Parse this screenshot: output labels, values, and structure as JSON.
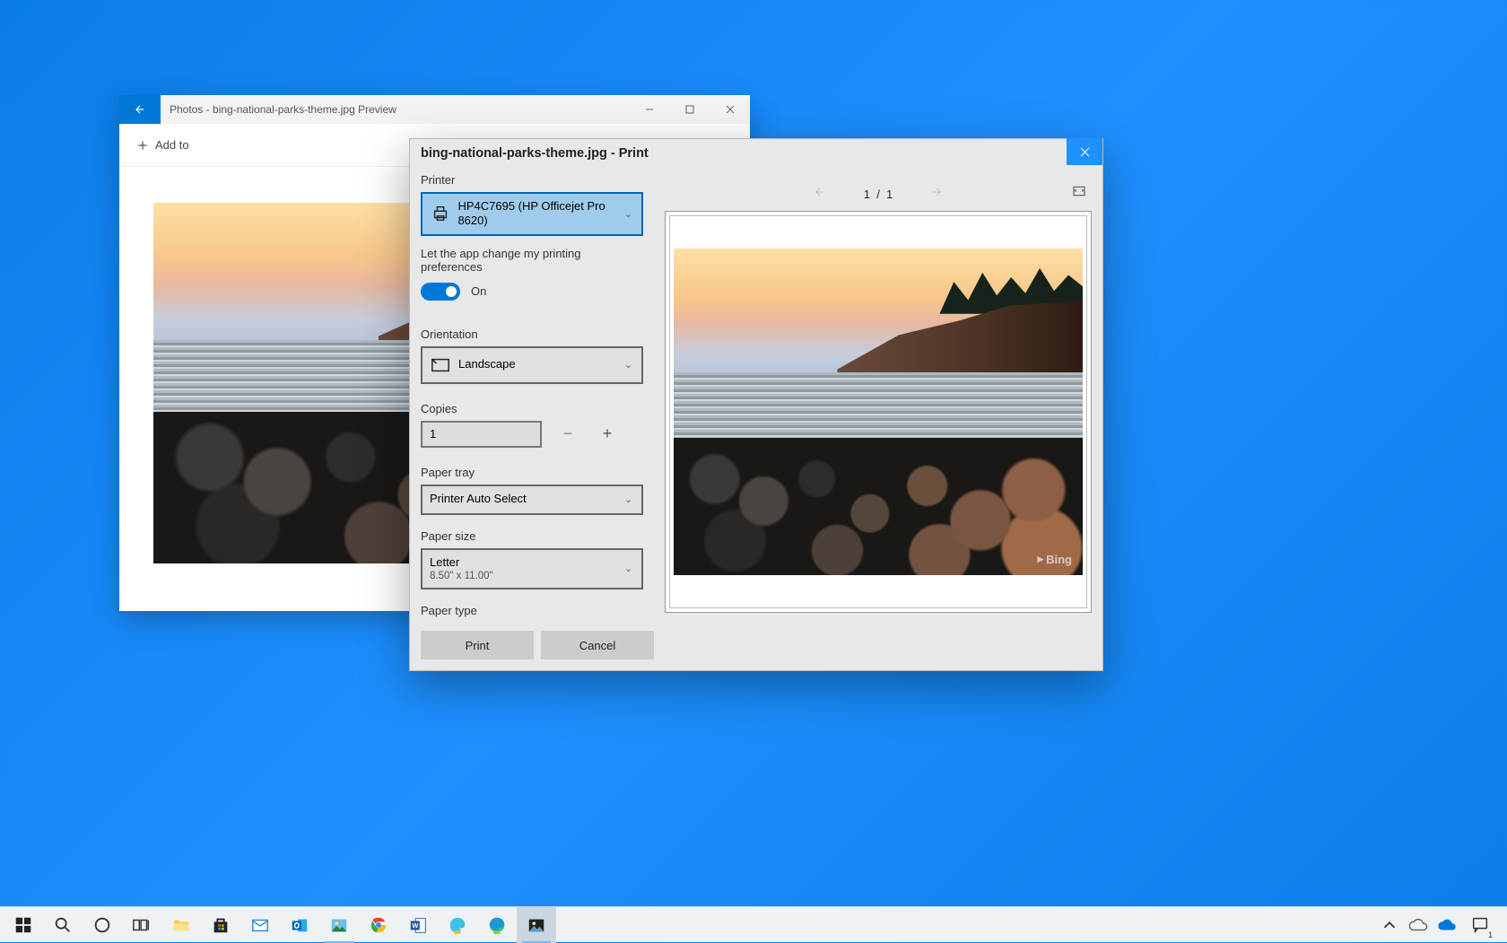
{
  "photos_window": {
    "title": "Photos - bing-national-parks-theme.jpg Preview",
    "add_to": "Add to",
    "image_watermark": "Bing"
  },
  "print_dialog": {
    "title": "bing-national-parks-theme.jpg - Print",
    "printer_label": "Printer",
    "printer_value": "HP4C7695 (HP Officejet Pro 8620)",
    "pref_label": "Let the app change my printing preferences",
    "pref_toggle": "On",
    "orientation_label": "Orientation",
    "orientation_value": "Landscape",
    "copies_label": "Copies",
    "copies_value": "1",
    "tray_label": "Paper tray",
    "tray_value": "Printer Auto Select",
    "size_label": "Paper size",
    "size_value": "Letter",
    "size_sub": "8.50\" x 11.00\"",
    "type_label": "Paper type",
    "print_btn": "Print",
    "cancel_btn": "Cancel",
    "page_current": "1",
    "page_sep": "/",
    "page_total": "1"
  }
}
